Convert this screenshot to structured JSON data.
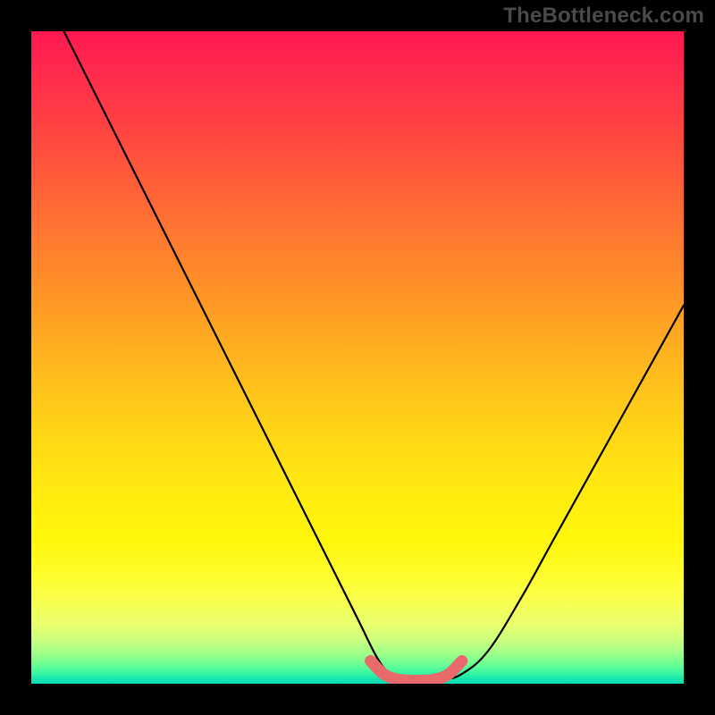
{
  "watermark": "TheBottleneck.com",
  "chart_data": {
    "type": "line",
    "title": "",
    "xlabel": "",
    "ylabel": "",
    "xlim": [
      0,
      100
    ],
    "ylim": [
      0,
      100
    ],
    "series": [
      {
        "name": "bottleneck-curve",
        "x": [
          5,
          10,
          15,
          20,
          25,
          30,
          35,
          40,
          45,
          50,
          53,
          55,
          57,
          60,
          63,
          66,
          70,
          75,
          80,
          85,
          90,
          95,
          100
        ],
        "values": [
          100,
          90,
          80,
          70,
          60,
          50,
          40,
          30,
          20,
          10,
          4,
          1.5,
          0.6,
          0.5,
          0.6,
          1.5,
          5,
          13,
          22,
          31,
          40,
          49,
          58
        ]
      }
    ],
    "highlight": {
      "name": "flat-bottom-marker",
      "x": [
        52,
        54,
        56,
        58,
        60,
        62,
        64,
        66
      ],
      "values": [
        3.5,
        1.5,
        0.7,
        0.5,
        0.5,
        0.7,
        1.5,
        3.5
      ],
      "color": "#e86a6a"
    },
    "background": {
      "type": "vertical-gradient",
      "stops": [
        {
          "pos": 0.0,
          "color": "#ff1750"
        },
        {
          "pos": 0.32,
          "color": "#ff7a2f"
        },
        {
          "pos": 0.62,
          "color": "#ffd716"
        },
        {
          "pos": 0.84,
          "color": "#fdfd30"
        },
        {
          "pos": 0.95,
          "color": "#9cff88"
        },
        {
          "pos": 1.0,
          "color": "#0ad8b4"
        }
      ]
    }
  }
}
